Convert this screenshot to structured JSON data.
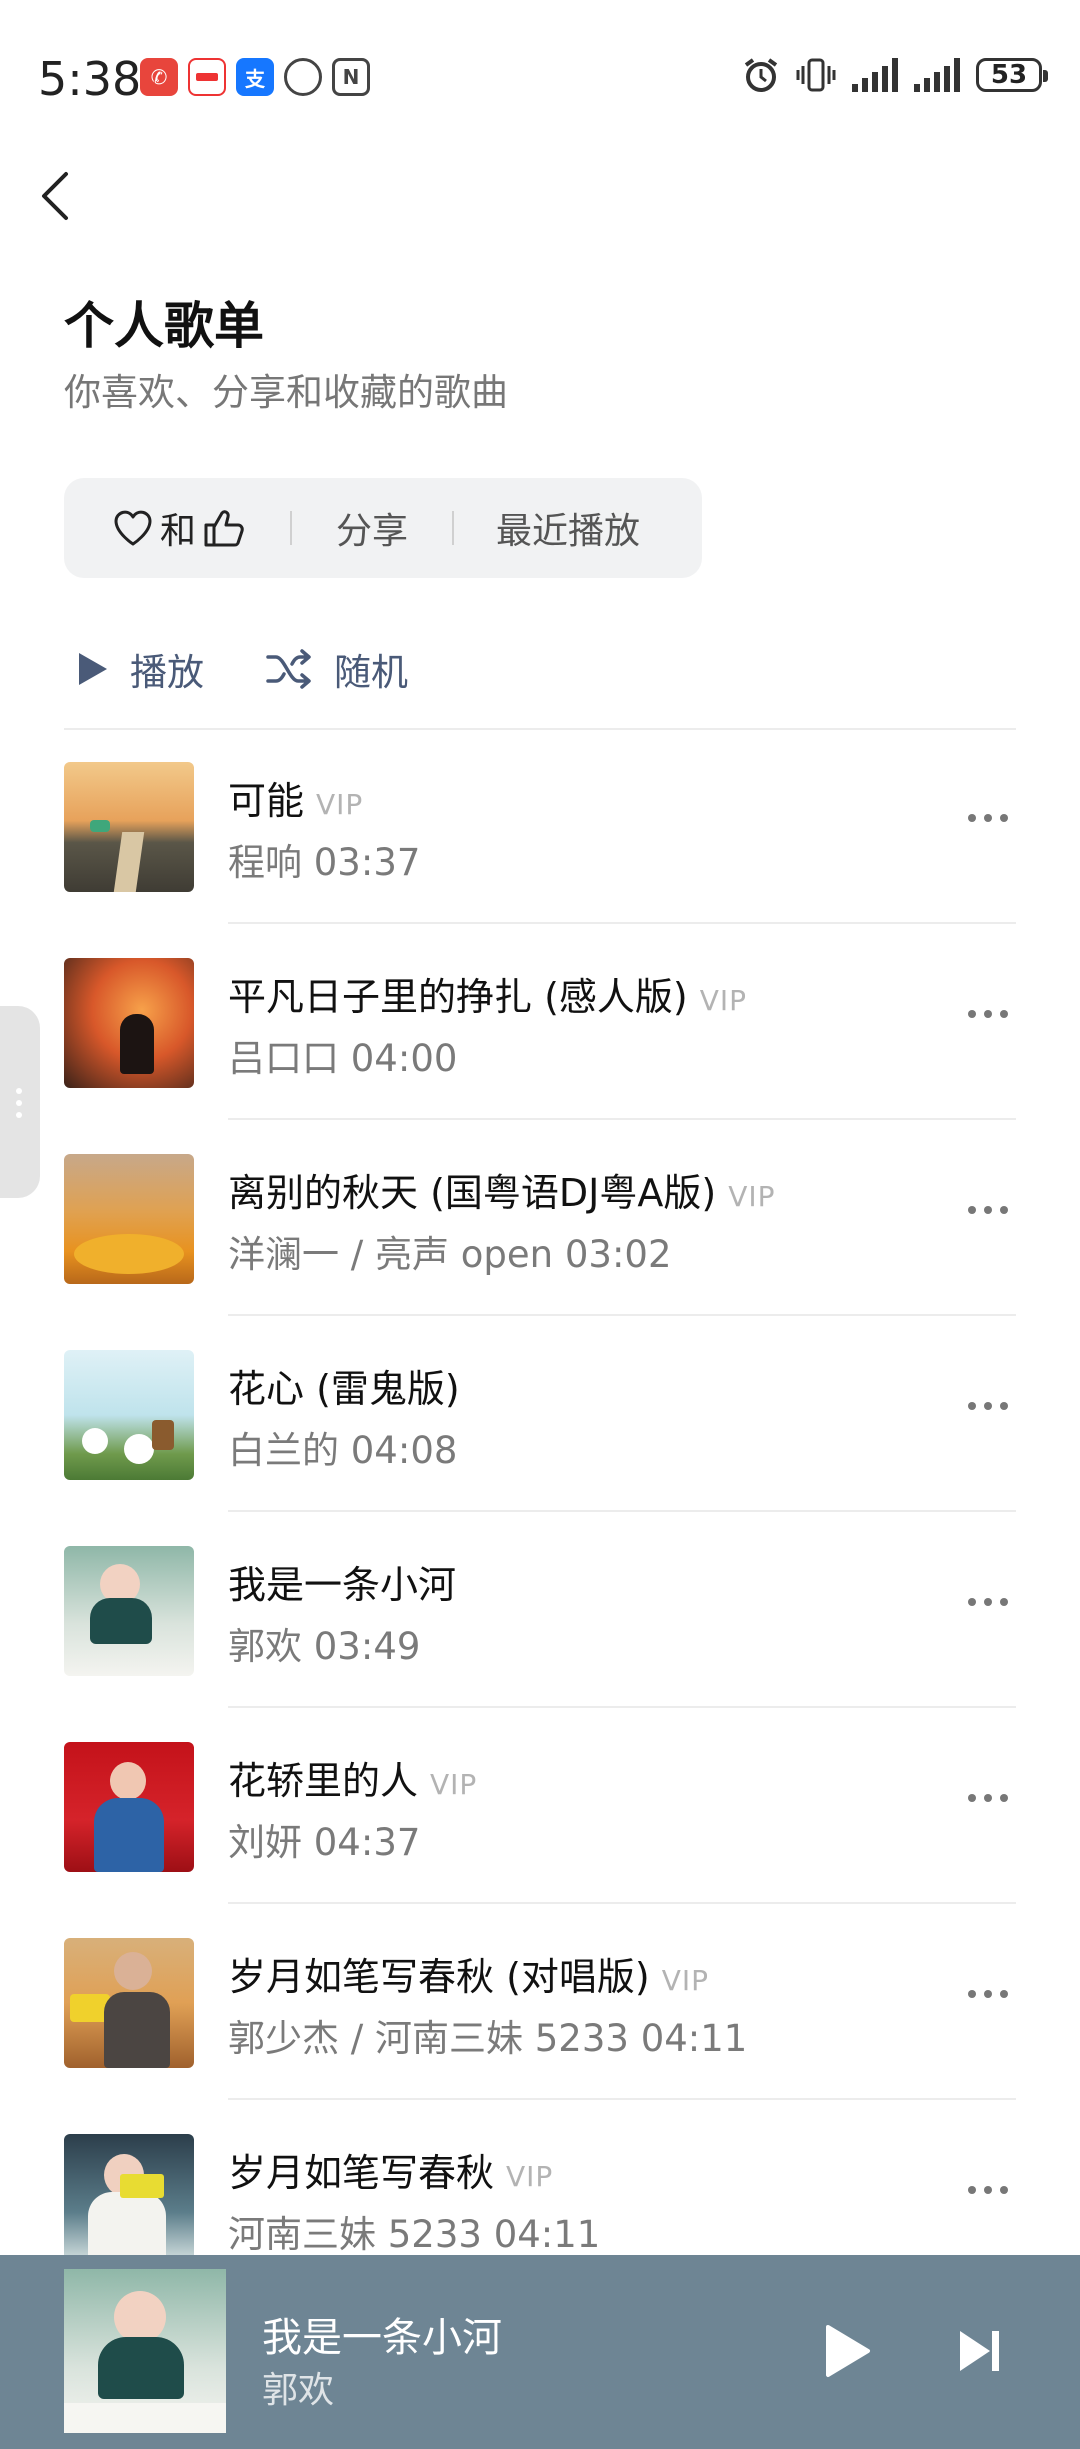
{
  "status_bar": {
    "time": "5:38",
    "battery": "53"
  },
  "header": {
    "title": "个人歌单",
    "subtitle": "你喜欢、分享和收藏的歌曲"
  },
  "filters": {
    "like_connector": "和",
    "share": "分享",
    "recent": "最近播放"
  },
  "actions": {
    "play": "播放",
    "shuffle": "随机"
  },
  "songs": [
    {
      "title": "可能",
      "vip": "VIP",
      "artist": "程响",
      "duration": "03:37"
    },
    {
      "title": "平凡日子里的挣扎 (感人版)",
      "vip": "VIP",
      "artist": "吕口口",
      "duration": "04:00"
    },
    {
      "title": "离别的秋天 (国粤语DJ粤A版)",
      "vip": "VIP",
      "artist": "洋澜一 / 亮声 open",
      "duration": "03:02"
    },
    {
      "title": "花心 (雷鬼版)",
      "vip": "",
      "artist": "白兰的",
      "duration": "04:08"
    },
    {
      "title": "我是一条小河",
      "vip": "",
      "artist": "郭欢",
      "duration": "03:49"
    },
    {
      "title": "花轿里的人",
      "vip": "VIP",
      "artist": "刘妍",
      "duration": "04:37"
    },
    {
      "title": "岁月如笔写春秋 (对唱版)",
      "vip": "VIP",
      "artist": "郭少杰 / 河南三妹 5233",
      "duration": "04:11"
    },
    {
      "title": "岁月如笔写春秋",
      "vip": "VIP",
      "artist": "河南三妹 5233",
      "duration": "04:11"
    }
  ],
  "player": {
    "title": "我是一条小河",
    "artist": "郭欢"
  },
  "colors": {
    "accent": "#4a5a78",
    "player_bg": "#6e8594",
    "chip_bg": "#f1f2f3"
  },
  "icons": {
    "back": "chevron-left-icon",
    "heart": "heart-icon",
    "thumb": "thumbs-up-icon",
    "play": "play-icon",
    "shuffle": "shuffle-icon",
    "more": "more-dots-icon",
    "next": "skip-next-icon"
  }
}
